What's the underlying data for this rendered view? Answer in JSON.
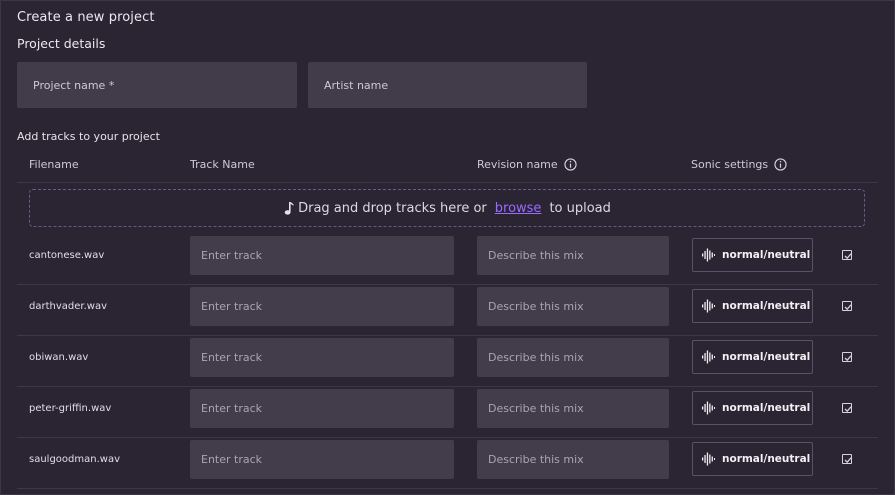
{
  "page": {
    "title": "Create a new project",
    "details_heading": "Project details",
    "project_name_placeholder": "Project name *",
    "artist_name_placeholder": "Artist name",
    "tracks_heading": "Add tracks to your project"
  },
  "table": {
    "headers": {
      "filename": "Filename",
      "track_name": "Track Name",
      "revision_name": "Revision name",
      "sonic_settings": "Sonic settings"
    },
    "dropzone": {
      "text_before": "Drag and drop tracks here or",
      "browse": "browse",
      "text_after": "to upload"
    },
    "rows": [
      {
        "filename": "cantonese.wav",
        "track_placeholder": "Enter track",
        "revision_placeholder": "Describe this mix",
        "sonic": "normal/neutral",
        "checked": true
      },
      {
        "filename": "darthvader.wav",
        "track_placeholder": "Enter track",
        "revision_placeholder": "Describe this mix",
        "sonic": "normal/neutral",
        "checked": true
      },
      {
        "filename": "obiwan.wav",
        "track_placeholder": "Enter track",
        "revision_placeholder": "Describe this mix",
        "sonic": "normal/neutral",
        "checked": true
      },
      {
        "filename": "peter-griffin.wav",
        "track_placeholder": "Enter track",
        "revision_placeholder": "Describe this mix",
        "sonic": "normal/neutral",
        "checked": true
      },
      {
        "filename": "saulgoodman.wav",
        "track_placeholder": "Enter track",
        "revision_placeholder": "Describe this mix",
        "sonic": "normal/neutral",
        "checked": true
      }
    ]
  },
  "colors": {
    "background": "#2b2433",
    "field": "#423b4a",
    "accent": "#9a6bff"
  },
  "icons": {
    "info": "info-icon",
    "note": "music-note-icon",
    "wave": "waveform-icon",
    "check": "checkbox-icon"
  }
}
